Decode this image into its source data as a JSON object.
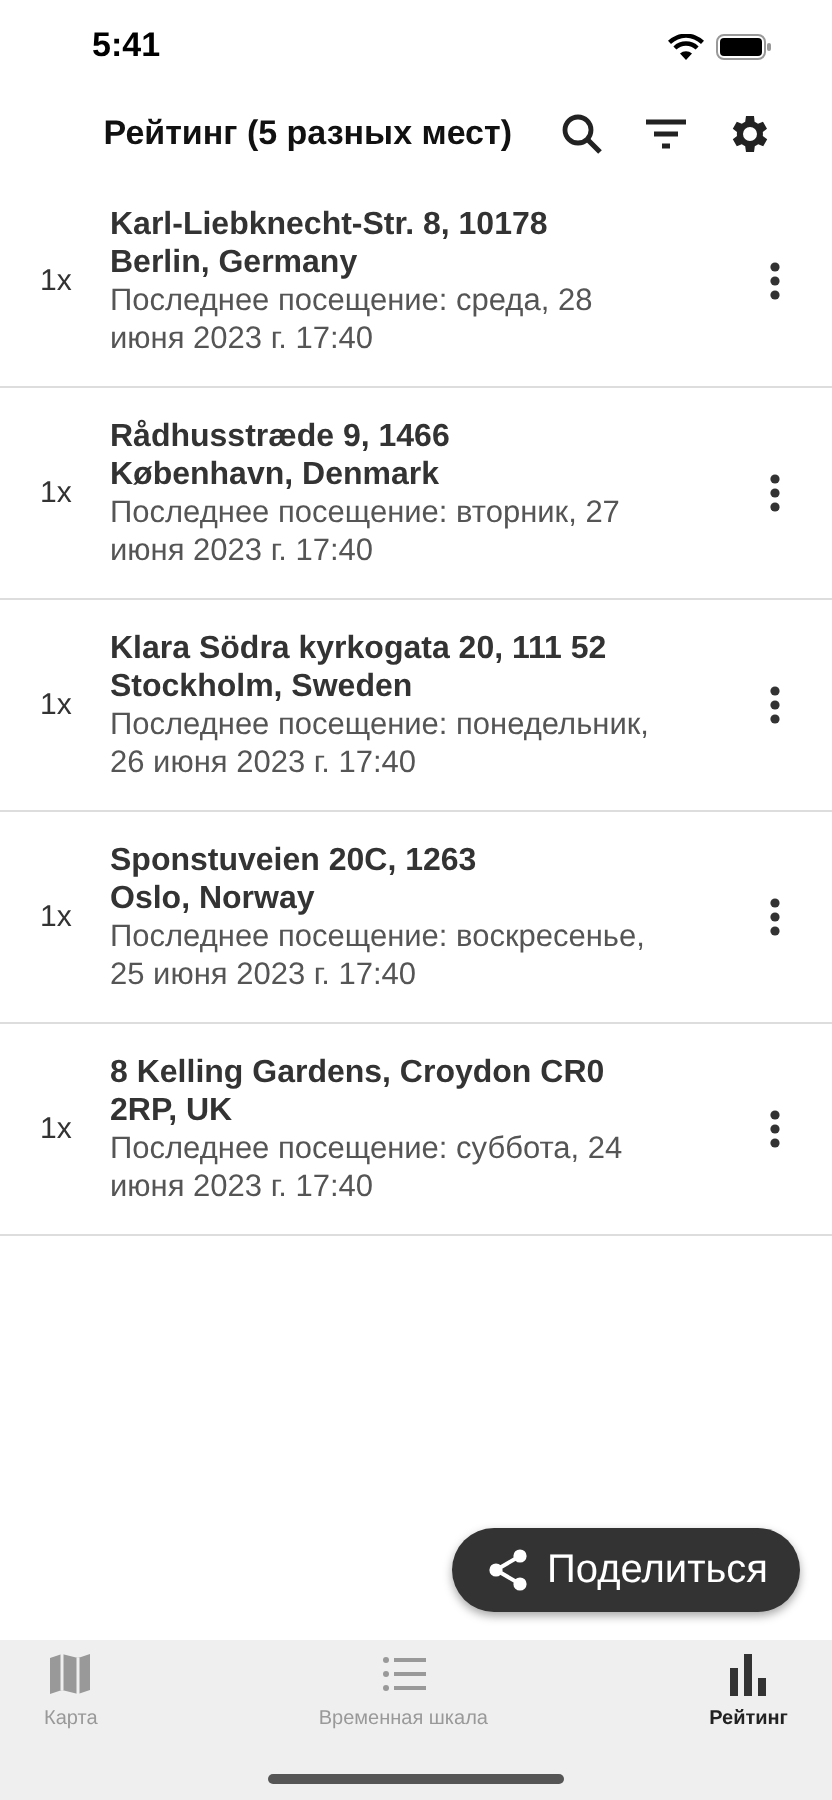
{
  "status_bar": {
    "time": "5:41"
  },
  "header": {
    "title": "Рейтинг (5 разных мест)"
  },
  "places": [
    {
      "count": "1x",
      "address": "Karl-Liebknecht-Str. 8, 10178\nBerlin, Germany",
      "last_visit": "Последнее посещение: среда, 28\nиюня 2023 г. 17:40"
    },
    {
      "count": "1x",
      "address": "Rådhusstræde 9, 1466\nKøbenhavn, Denmark",
      "last_visit": "Последнее посещение: вторник, 27\nиюня 2023 г. 17:40"
    },
    {
      "count": "1x",
      "address": "Klara Södra kyrkogata 20, 111 52\nStockholm, Sweden",
      "last_visit": "Последнее посещение: понедельник,\n26 июня 2023 г. 17:40"
    },
    {
      "count": "1x",
      "address": "Sponstuveien 20C, 1263\nOslo, Norway",
      "last_visit": "Последнее посещение: воскресенье,\n25 июня 2023 г. 17:40"
    },
    {
      "count": "1x",
      "address": "8 Kelling Gardens, Croydon CR0\n2RP, UK",
      "last_visit": "Последнее посещение: суббота, 24\nиюня 2023 г. 17:40"
    }
  ],
  "share_button": {
    "label": "Поделиться"
  },
  "tabs": [
    {
      "kind": "map",
      "label": "Карта",
      "selected": false
    },
    {
      "kind": "list",
      "label": "Временная шкала",
      "selected": false
    },
    {
      "kind": "chart",
      "label": "Рейтинг",
      "selected": true
    }
  ]
}
